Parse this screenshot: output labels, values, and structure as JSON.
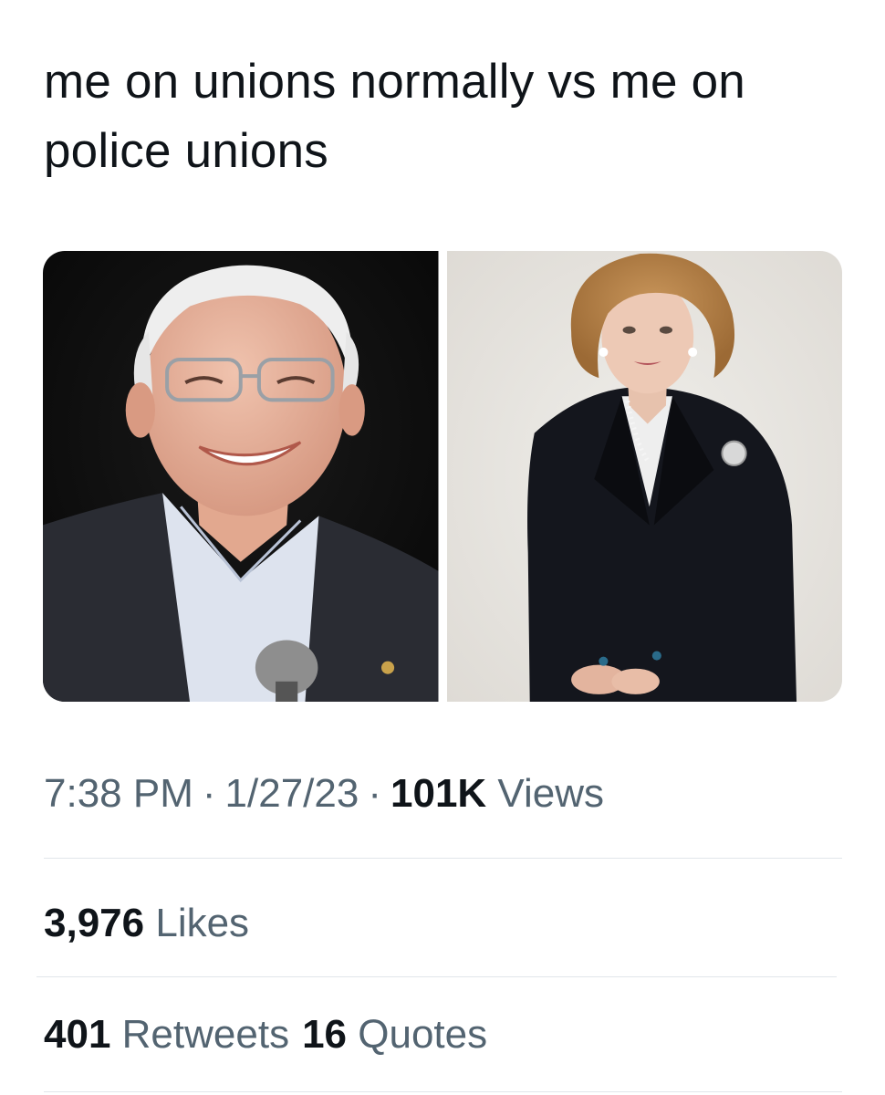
{
  "tweet": {
    "text": "me on unions normally vs me on police unions"
  },
  "media": {
    "photos": [
      {
        "background": "#0b0b0b"
      },
      {
        "background": "#e8e6e1"
      }
    ]
  },
  "meta": {
    "time": "7:38 PM",
    "separator": "·",
    "date": "1/27/23",
    "views_count": "101K",
    "views_label": "Views"
  },
  "stats": {
    "likes_count": "3,976",
    "likes_label": "Likes",
    "retweets_count": "401",
    "retweets_label": "Retweets",
    "quotes_count": "16",
    "quotes_label": "Quotes"
  },
  "colors": {
    "text_primary": "#0f1419",
    "text_secondary": "#536471",
    "divider": "#e1e6ea"
  }
}
